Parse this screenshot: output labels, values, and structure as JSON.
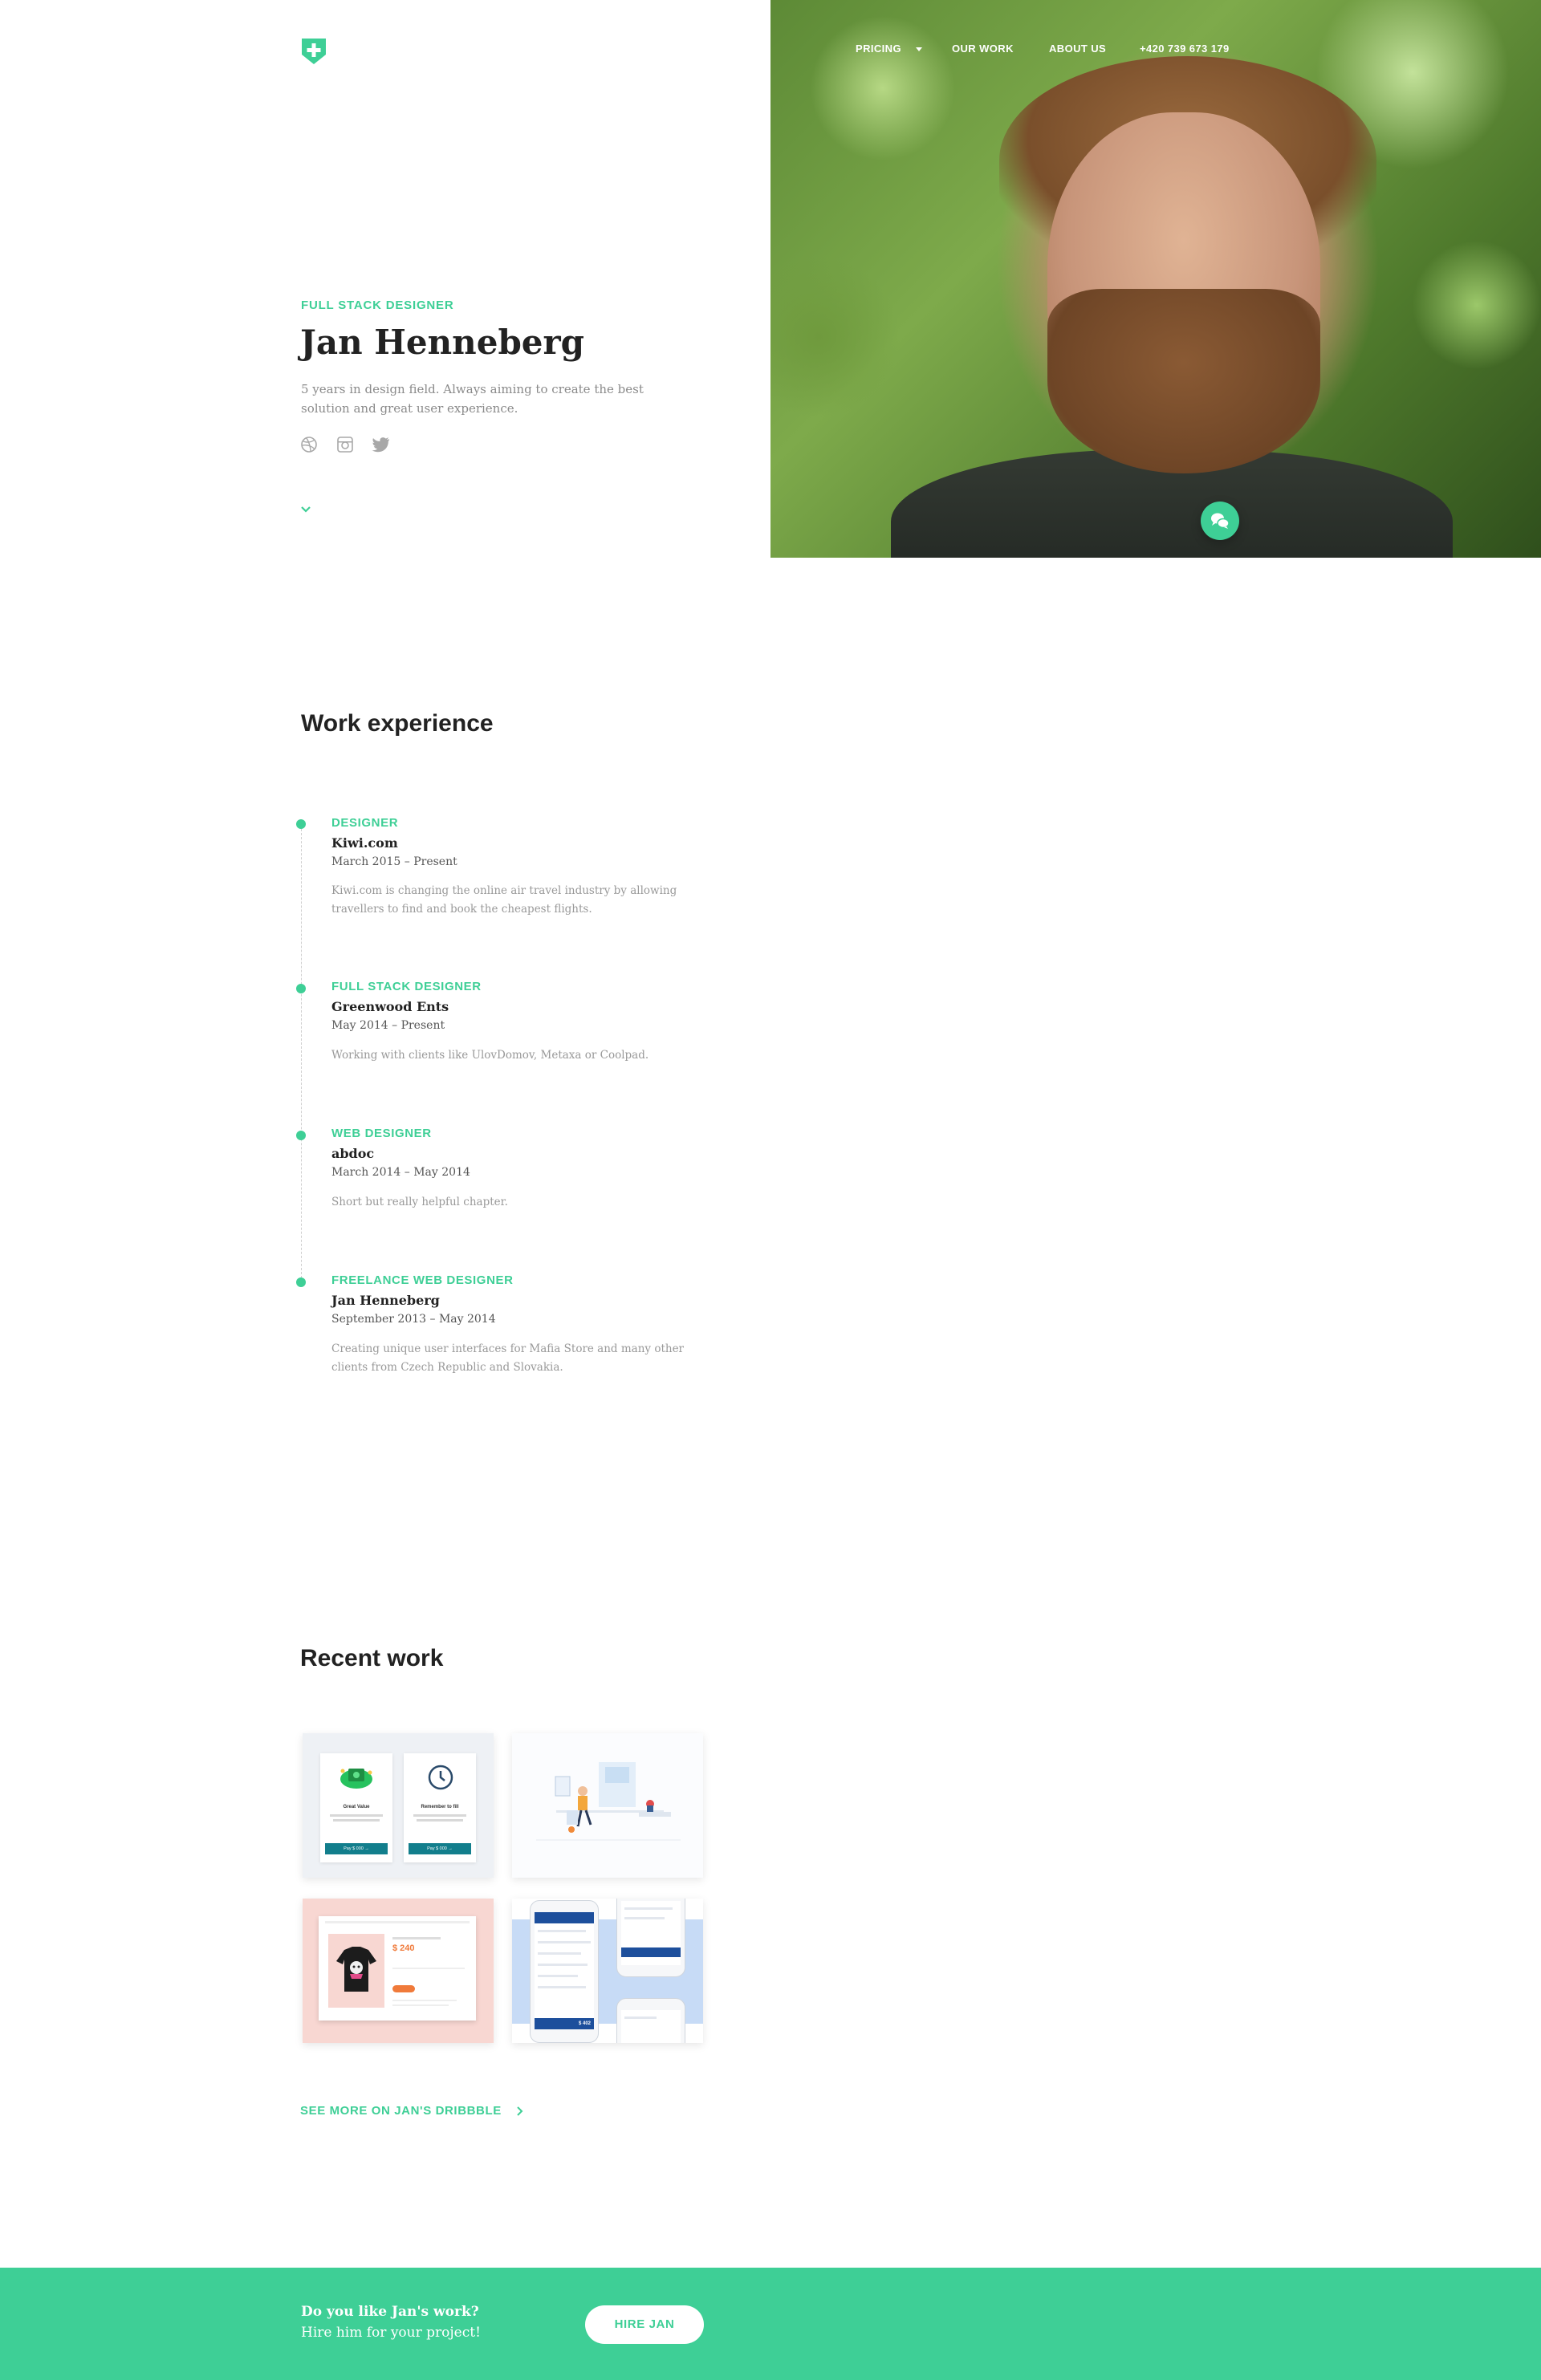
{
  "colors": {
    "accent": "#3ecf96",
    "text_dark": "#222222",
    "text_muted": "#999999",
    "footer_bg": "#3ecf96"
  },
  "header": {
    "logo_icon": "shield-plus-icon",
    "nav": {
      "pricing": "PRICING",
      "our_work": "OUR WORK",
      "about_us": "ABOUT US",
      "phone": "+420 739 673 179"
    }
  },
  "hero": {
    "subtitle": "FULL STACK DESIGNER",
    "name": "Jan Henneberg",
    "bio": "5 years in design field. Always aiming to create the best solution and great user experience.",
    "social_icons": [
      "dribbble-icon",
      "instagram-icon",
      "twitter-icon"
    ],
    "scroll_icon": "chevron-down-icon",
    "chat_icon": "chat-bubbles-icon"
  },
  "work": {
    "heading": "Work experience",
    "items": [
      {
        "role": "DESIGNER",
        "company": "Kiwi.com",
        "dates": "March 2015 – Present",
        "description": "Kiwi.com is changing the online air travel industry by allowing travellers to find and book the cheapest flights."
      },
      {
        "role": "FULL STACK DESIGNER",
        "company": "Greenwood Ents",
        "dates": "May 2014 – Present",
        "description": "Working with clients like UlovDomov, Metaxa or Coolpad."
      },
      {
        "role": "WEB DESIGNER",
        "company": "abdoc",
        "dates": "March 2014 – May 2014",
        "description": "Short but really helpful chapter."
      },
      {
        "role": "FREELANCE WEB DESIGNER",
        "company": "Jan Henneberg",
        "dates": "September 2013 – May 2014",
        "description": "Creating unique user interfaces for Mafia Store and many other clients from Czech Republic and Slovakia."
      }
    ]
  },
  "recent": {
    "heading": "Recent work",
    "card1": {
      "left_title": "Great Value",
      "left_button": "Pay $ 000 →",
      "right_title": "Remember to fill",
      "right_button": "Pay $ 000 →"
    },
    "card3": {
      "price": "$ 240"
    },
    "card4": {
      "price": "$ 402"
    },
    "see_more": "SEE MORE ON JAN'S DRIBBBLE",
    "see_more_icon": "chevron-right-icon"
  },
  "footer": {
    "line1": "Do you like Jan's work?",
    "line2": "Hire him for your project!",
    "cta": "HIRE JAN"
  }
}
